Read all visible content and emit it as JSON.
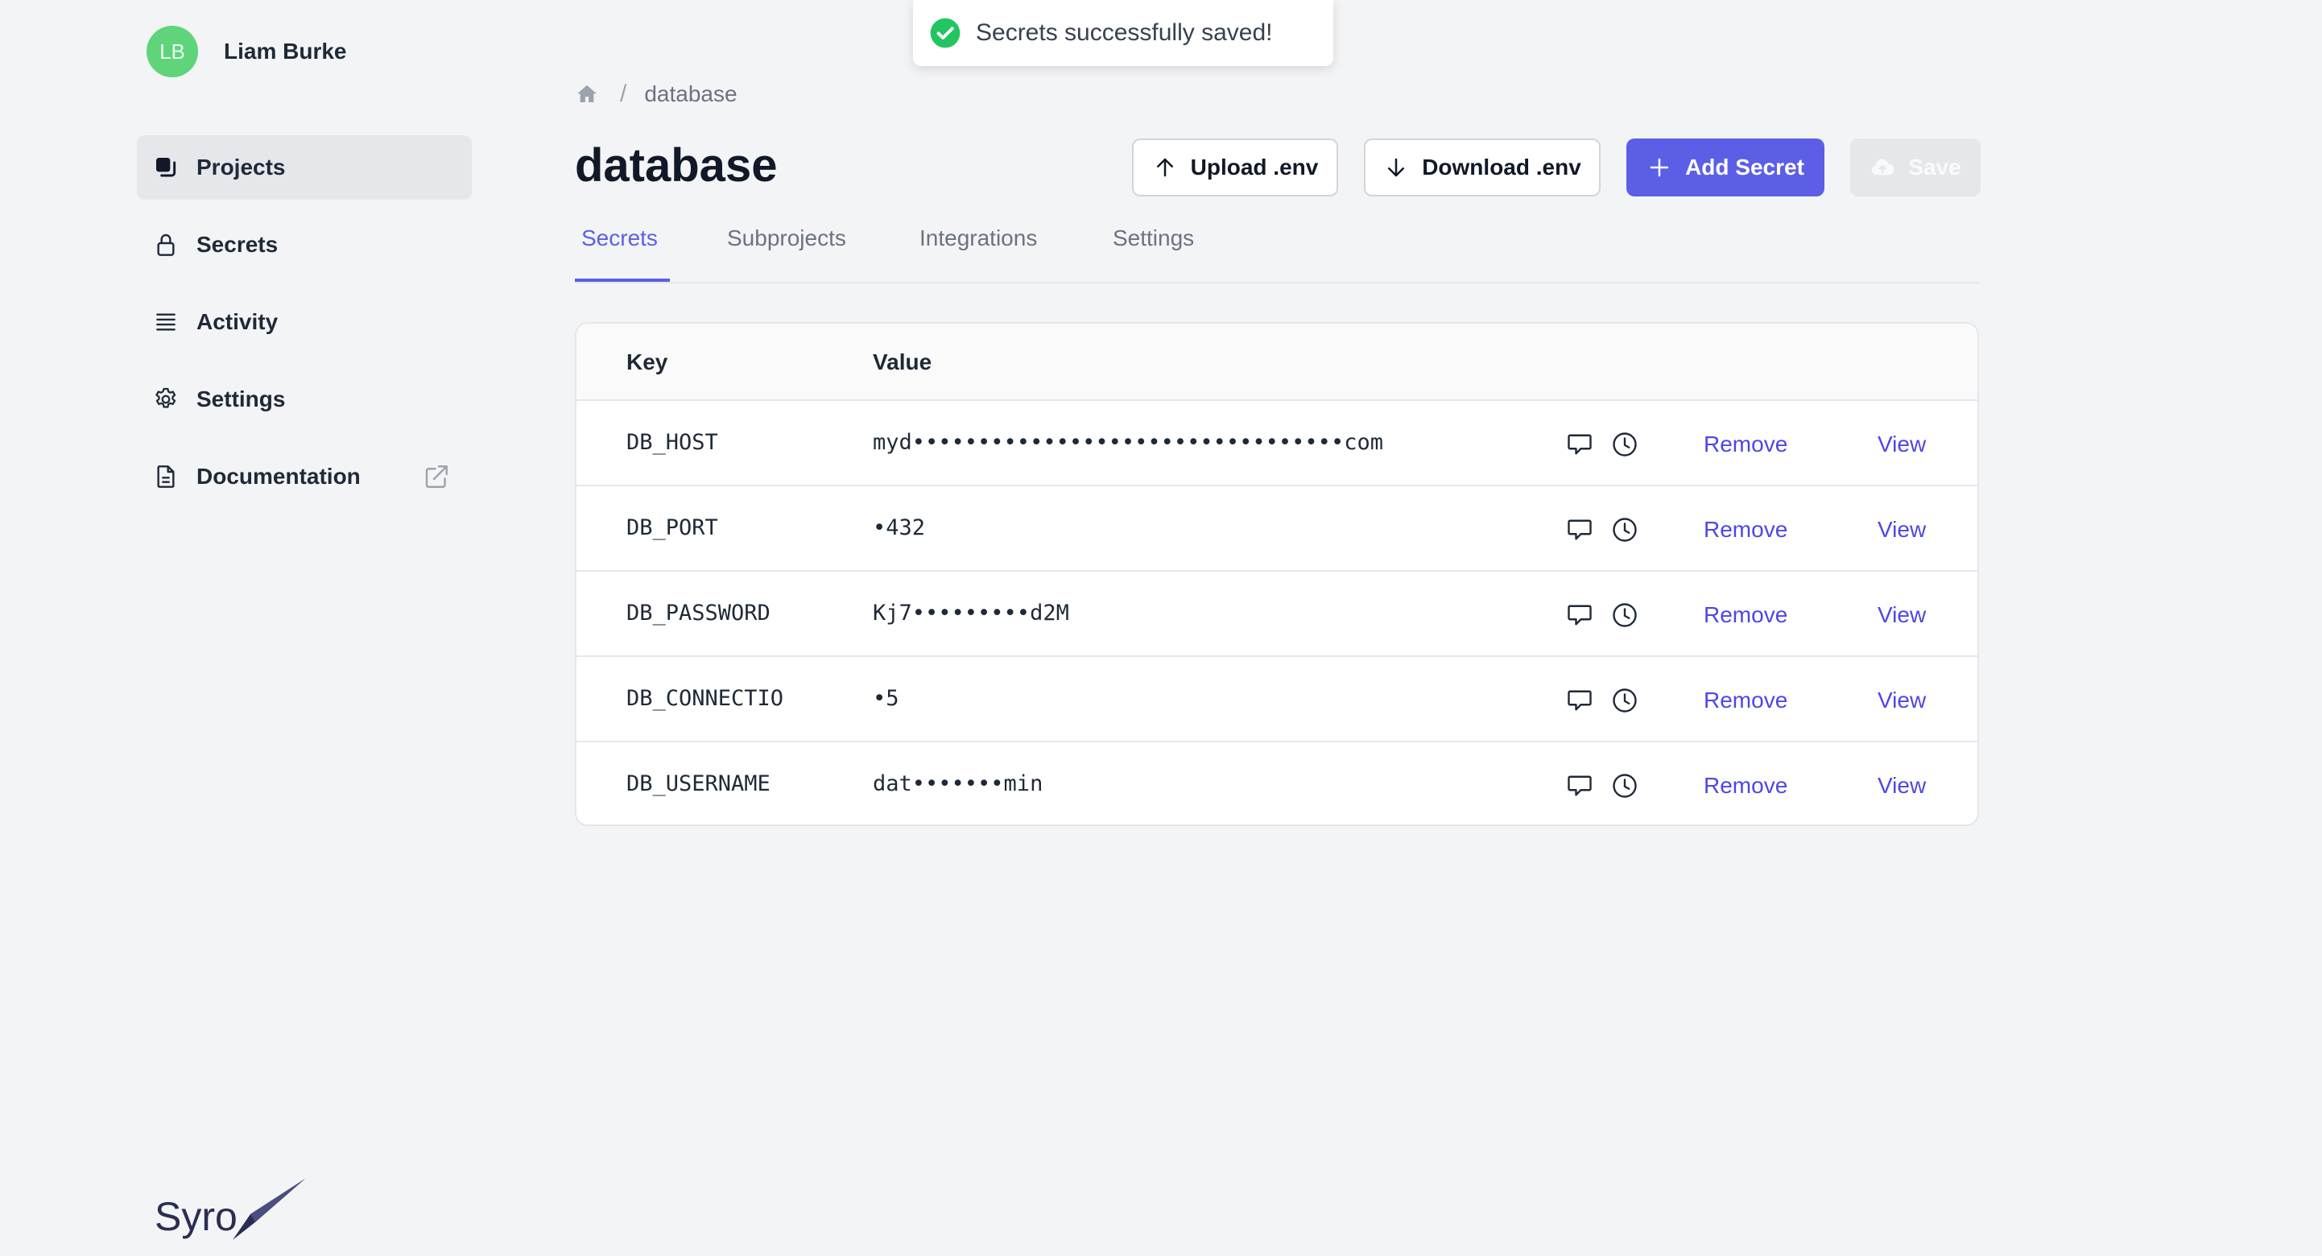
{
  "user": {
    "initials": "LB",
    "name": "Liam Burke"
  },
  "sidebar": {
    "items": [
      {
        "label": "Projects",
        "icon": "projects-icon",
        "active": true
      },
      {
        "label": "Secrets",
        "icon": "lock-icon"
      },
      {
        "label": "Activity",
        "icon": "list-icon"
      },
      {
        "label": "Settings",
        "icon": "gear-icon"
      },
      {
        "label": "Documentation",
        "icon": "document-icon",
        "external_icon": "external-link-icon"
      }
    ]
  },
  "logo": {
    "text": "Syro"
  },
  "toast": {
    "message": "Secrets successfully saved!",
    "status": "success",
    "color": "#22c55e"
  },
  "breadcrumb": {
    "home_icon": "home-icon",
    "current": "database"
  },
  "page": {
    "title": "database"
  },
  "actions": {
    "upload_label": "Upload .env",
    "download_label": "Download .env",
    "add_label": "Add Secret",
    "save_label": "Save"
  },
  "tabs": [
    {
      "label": "Secrets",
      "active": true
    },
    {
      "label": "Subprojects"
    },
    {
      "label": "Integrations"
    },
    {
      "label": "Settings"
    }
  ],
  "table": {
    "headers": {
      "key": "Key",
      "value": "Value"
    },
    "rows": [
      {
        "key": "DB_HOST",
        "value": "myd•••••••••••••••••••••••••••••••••com",
        "remove": "Remove",
        "view": "View"
      },
      {
        "key": "DB_PORT",
        "value": "•432",
        "remove": "Remove",
        "view": "View"
      },
      {
        "key": "DB_PASSWORD",
        "value": "Kj7•••••••••d2M",
        "remove": "Remove",
        "view": "View"
      },
      {
        "key": "DB_CONNECTIO",
        "value": "•5",
        "remove": "Remove",
        "view": "View"
      },
      {
        "key": "DB_USERNAME",
        "value": "dat•••••••min",
        "remove": "Remove",
        "view": "View"
      }
    ]
  },
  "colors": {
    "accent": "#5b5fe6",
    "link": "#4f46e5",
    "avatar": "#5fd47a",
    "background": "#f3f4f6"
  }
}
